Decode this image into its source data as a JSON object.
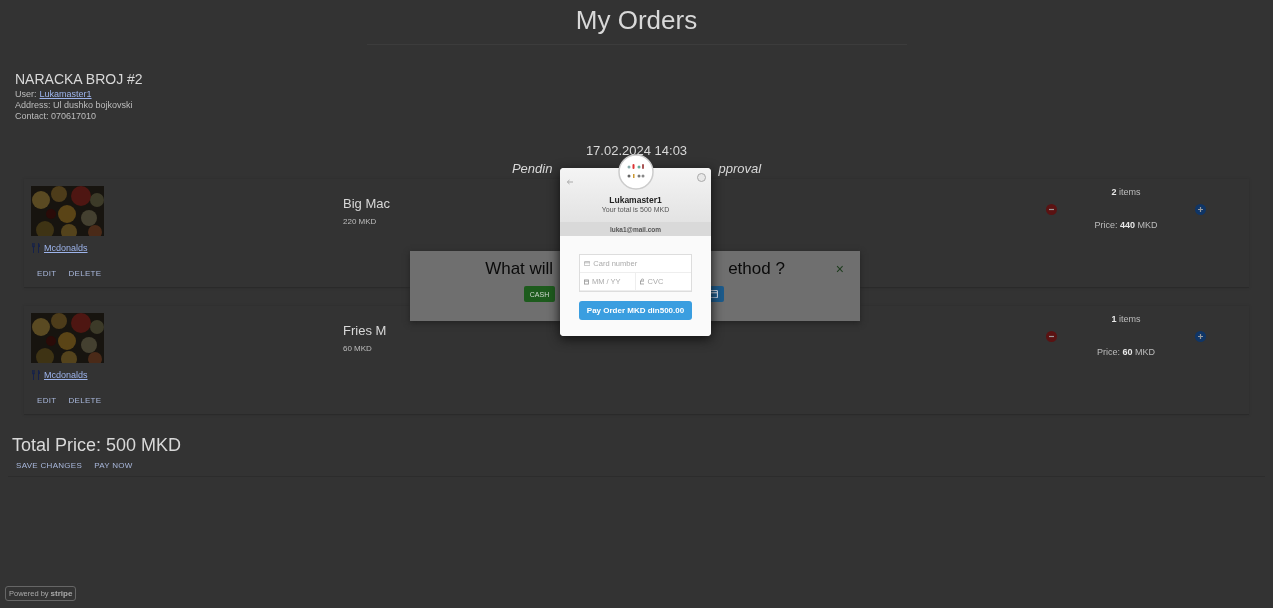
{
  "page": {
    "title": "My Orders"
  },
  "order": {
    "heading": "NARACKA BROJ #2",
    "user_label": "User:",
    "user": "Lukamaster1",
    "address": "Address: Ul dushko bojkovski",
    "contact": "Contact: 070617010",
    "date": "17.02.2024 14:03",
    "status_parts": [
      "Pendin",
      "pproval"
    ]
  },
  "items": [
    {
      "name": "Big Mac",
      "price": "220 MKD",
      "restaurant": "Mcdonalds",
      "count": "**2** items",
      "total": "Price: **440** MKD",
      "actions": [
        "EDIT",
        "DELETE"
      ]
    },
    {
      "name": "Fries M",
      "price": "60 MKD",
      "restaurant": "Mcdonalds",
      "count": "**1** items",
      "total": "Price: **60** MKD",
      "actions": [
        "EDIT",
        "DELETE"
      ]
    }
  ],
  "total": "Total Price: 500 MKD",
  "footer_actions": [
    "SAVE CHANGES",
    "PAY NOW"
  ],
  "payment_modal": {
    "title_parts": [
      "What will",
      "ethod ?"
    ],
    "close": "×",
    "buttons": [
      {
        "kind": "cash",
        "label": "CASH"
      },
      {
        "kind": "card"
      }
    ]
  },
  "checkout": {
    "name": "Lukamaster1",
    "subtitle": "Your total is 500 MKD",
    "email": "luka1@mail.com",
    "card_placeholder": "Card number",
    "expiry_placeholder": "MM / YY",
    "cvc_placeholder": "CVC",
    "pay_button": "Pay Order MKD din500.00"
  },
  "stripe_badge": {
    "prefix": "Powered by",
    "brand": "stripe"
  }
}
